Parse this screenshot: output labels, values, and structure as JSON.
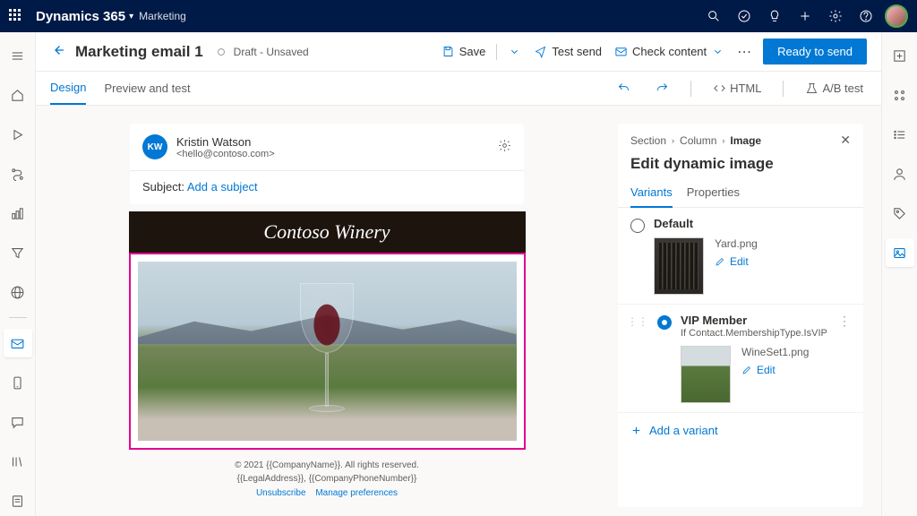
{
  "topbar": {
    "brand": "Dynamics 365",
    "module": "Marketing"
  },
  "cmdbar": {
    "title": "Marketing email 1",
    "status": "Draft - Unsaved",
    "save": "Save",
    "testSend": "Test send",
    "checkContent": "Check content",
    "ready": "Ready to send"
  },
  "tabs": {
    "design": "Design",
    "preview": "Preview and test",
    "html": "HTML",
    "ab": "A/B test"
  },
  "card": {
    "initials": "KW",
    "sender": "Kristin Watson",
    "email": "<hello@contoso.com>",
    "subjectLabel": "Subject:",
    "subjectLink": "Add a subject"
  },
  "emailBody": {
    "logo": "Contoso Winery"
  },
  "footer": {
    "line1": "© 2021 {{CompanyName}}. All rights reserved.",
    "line2": "{{LegalAddress}}, {{CompanyPhoneNumber}}",
    "unsub": "Unsubscribe",
    "prefs": "Manage preferences"
  },
  "panel": {
    "crumb1": "Section",
    "crumb2": "Column",
    "crumb3": "Image",
    "title": "Edit dynamic image",
    "tab1": "Variants",
    "tab2": "Properties",
    "default": {
      "name": "Default",
      "file": "Yard.png",
      "edit": "Edit"
    },
    "vip": {
      "name": "VIP Member",
      "cond": "If Contact.MembershipType.IsVIP",
      "file": "WineSet1.png",
      "edit": "Edit"
    },
    "add": "Add a variant"
  }
}
